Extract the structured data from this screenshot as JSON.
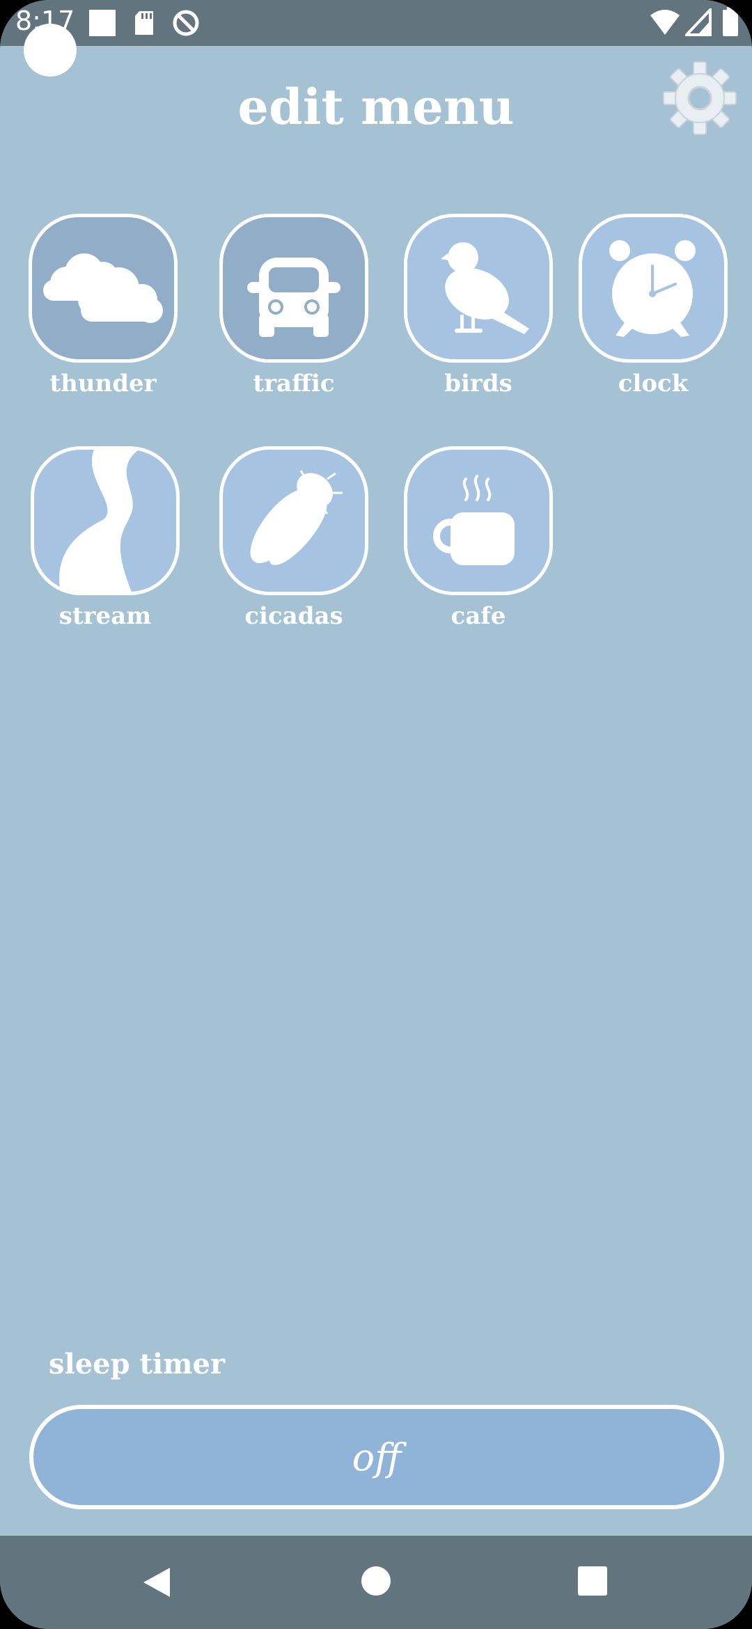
{
  "status_bar": {
    "time": "8:17",
    "icons": [
      "square-notification-icon",
      "sd-card-icon",
      "sync-blocked-icon",
      "wifi-icon",
      "cellular-signal-icon",
      "battery-icon"
    ]
  },
  "header": {
    "title": "edit menu",
    "settings_icon": "gear-icon"
  },
  "sounds": [
    {
      "label": "thunder",
      "icon": "cloud-icon",
      "selected": true
    },
    {
      "label": "traffic",
      "icon": "car-icon",
      "selected": true
    },
    {
      "label": "birds",
      "icon": "bird-icon",
      "selected": false
    },
    {
      "label": "clock",
      "icon": "alarm-clock-icon",
      "selected": false
    },
    {
      "label": "stream",
      "icon": "stream-icon",
      "selected": false
    },
    {
      "label": "cicadas",
      "icon": "cicada-icon",
      "selected": false
    },
    {
      "label": "cafe",
      "icon": "coffee-cup-icon",
      "selected": false
    }
  ],
  "sleep_timer": {
    "label": "sleep timer",
    "value": "off"
  },
  "nav_bar": {
    "icons": [
      "back-icon",
      "home-icon",
      "recents-icon"
    ]
  },
  "colors": {
    "background": "#a4c2d3",
    "bars": "#62757f",
    "tile_selected": "#91adc8",
    "tile_default": "#a6c4e2",
    "timer_button": "#8fb4d8",
    "foreground": "#ffffff"
  }
}
